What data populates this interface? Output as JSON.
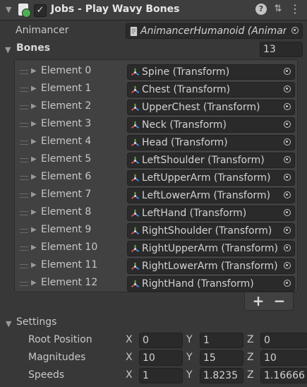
{
  "header": {
    "title": "Jobs - Play Wavy Bones",
    "enabled_mark": "✓",
    "icons": [
      "script-icon",
      "help-icon",
      "preset-icon",
      "kebab-menu-icon"
    ]
  },
  "animancer": {
    "label": "Animancer",
    "value": "AnimancerHumanoid (Animan"
  },
  "bones": {
    "label": "Bones",
    "count": "13",
    "items": [
      {
        "label": "Element 0",
        "value": "Spine (Transform)"
      },
      {
        "label": "Element 1",
        "value": "Chest (Transform)"
      },
      {
        "label": "Element 2",
        "value": "UpperChest (Transform)"
      },
      {
        "label": "Element 3",
        "value": "Neck (Transform)"
      },
      {
        "label": "Element 4",
        "value": "Head (Transform)"
      },
      {
        "label": "Element 5",
        "value": "LeftShoulder (Transform)"
      },
      {
        "label": "Element 6",
        "value": "LeftUpperArm (Transform)"
      },
      {
        "label": "Element 7",
        "value": "LeftLowerArm (Transform)"
      },
      {
        "label": "Element 8",
        "value": "LeftHand (Transform)"
      },
      {
        "label": "Element 9",
        "value": "RightShoulder (Transform)"
      },
      {
        "label": "Element 10",
        "value": "RightUpperArm (Transform)"
      },
      {
        "label": "Element 11",
        "value": "RightLowerArm (Transform)"
      },
      {
        "label": "Element 12",
        "value": "RightHand (Transform)"
      }
    ],
    "add_label": "+",
    "remove_label": "−"
  },
  "settings": {
    "label": "Settings",
    "rows": [
      {
        "label": "Root Position",
        "x": "0",
        "y": "1",
        "z": "0"
      },
      {
        "label": "Magnitudes",
        "x": "10",
        "y": "15",
        "z": "10"
      },
      {
        "label": "Speeds",
        "x": "1",
        "y": "1.8235",
        "z": "1.16666"
      }
    ],
    "axis_labels": {
      "x": "X",
      "y": "Y",
      "z": "Z"
    }
  }
}
